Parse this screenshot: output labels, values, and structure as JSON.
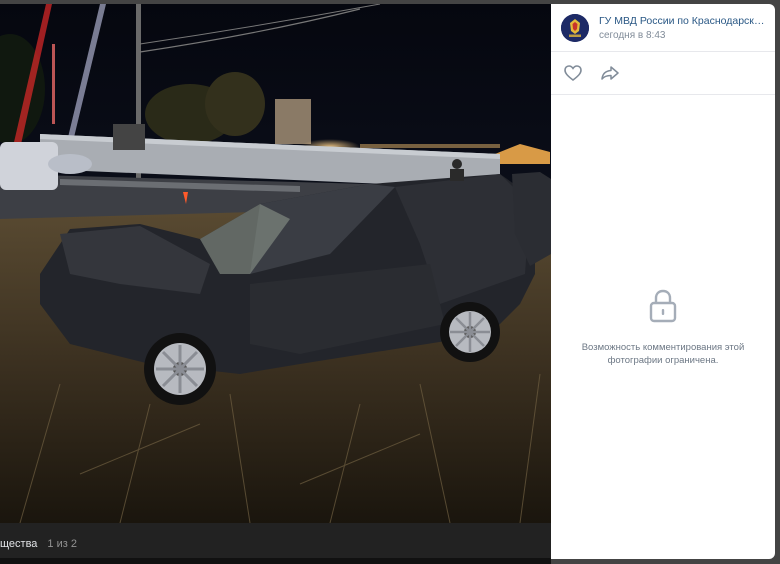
{
  "bottom_bar": {
    "album_name": "щества",
    "counter": "1 из 2"
  },
  "author": {
    "name": "ГУ МВД России по Краснодарскому краю",
    "date": "сегодня в 8:43",
    "avatar_text": "ГУ МВД"
  },
  "actions": {
    "like_icon": "heart-icon",
    "share_icon": "share-icon"
  },
  "comments": {
    "locked_icon": "lock-icon",
    "message_line1": "Возможность комментирования этой",
    "message_line2": "фотографии ограничена."
  },
  "colors": {
    "link": "#2a5885",
    "muted": "#818c99",
    "viewer_bg": "#444444"
  }
}
